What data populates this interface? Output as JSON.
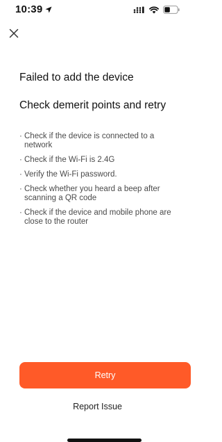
{
  "status_bar": {
    "time": "10:39"
  },
  "title": "Failed to add the device",
  "subtitle": "Check demerit points and retry",
  "tips": [
    {
      "bullet": "·",
      "text": "Check if the device is connected to a network"
    },
    {
      "bullet": "·",
      "text": "Check if the Wi-Fi is 2.4G"
    },
    {
      "bullet": "·",
      "text": "Verify the Wi-Fi password."
    },
    {
      "bullet": "·",
      "text": "Check whether you heard a beep after scanning a QR code"
    },
    {
      "bullet": "·",
      "text": "Check if the device and mobile phone are close to the router"
    }
  ],
  "actions": {
    "retry_label": "Retry",
    "report_label": "Report Issue"
  },
  "colors": {
    "accent": "#ff5a28",
    "text_primary": "#111111",
    "text_secondary": "#4a4a4a"
  },
  "icons": {
    "close": "close-icon",
    "location": "location-arrow-icon",
    "signal": "cellular-signal-icon",
    "wifi": "wifi-icon",
    "battery": "battery-icon"
  }
}
